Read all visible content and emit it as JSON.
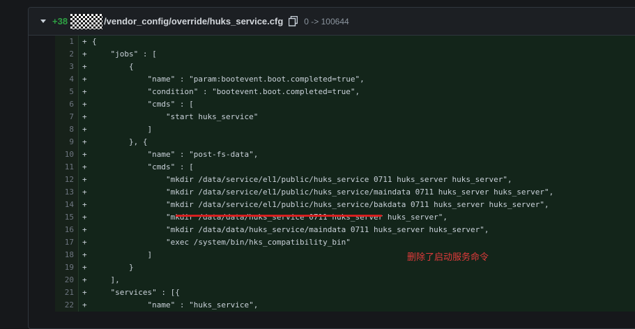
{
  "file_header": {
    "added_count": "+38",
    "path": "/vendor_config/override/huks_service.cfg",
    "mode_change": "0 -> 100644"
  },
  "diff_lines": [
    {
      "num": "1",
      "marker": "+",
      "text": "{"
    },
    {
      "num": "2",
      "marker": "+",
      "text": "    \"jobs\" : ["
    },
    {
      "num": "3",
      "marker": "+",
      "text": "        {"
    },
    {
      "num": "4",
      "marker": "+",
      "text": "            \"name\" : \"param:bootevent.boot.completed=true\","
    },
    {
      "num": "5",
      "marker": "+",
      "text": "            \"condition\" : \"bootevent.boot.completed=true\","
    },
    {
      "num": "6",
      "marker": "+",
      "text": "            \"cmds\" : ["
    },
    {
      "num": "7",
      "marker": "+",
      "text": "                \"start huks_service\""
    },
    {
      "num": "8",
      "marker": "+",
      "text": "            ]"
    },
    {
      "num": "9",
      "marker": "+",
      "text": "        }, {"
    },
    {
      "num": "10",
      "marker": "+",
      "text": "            \"name\" : \"post-fs-data\","
    },
    {
      "num": "11",
      "marker": "+",
      "text": "            \"cmds\" : ["
    },
    {
      "num": "12",
      "marker": "+",
      "text": "                \"mkdir /data/service/el1/public/huks_service 0711 huks_server huks_server\","
    },
    {
      "num": "13",
      "marker": "+",
      "text": "                \"mkdir /data/service/el1/public/huks_service/maindata 0711 huks_server huks_server\","
    },
    {
      "num": "14",
      "marker": "+",
      "text": "                \"mkdir /data/service/el1/public/huks_service/bakdata 0711 huks_server huks_server\","
    },
    {
      "num": "15",
      "marker": "+",
      "text": "                \"mkdir /data/data/huks_service 0711 huks_server huks_server\","
    },
    {
      "num": "16",
      "marker": "+",
      "text": "                \"mkdir /data/data/huks_service/maindata 0711 huks_server huks_server\","
    },
    {
      "num": "17",
      "marker": "+",
      "text": "                \"exec /system/bin/hks_compatibility_bin\""
    },
    {
      "num": "18",
      "marker": "+",
      "text": "            ]"
    },
    {
      "num": "19",
      "marker": "+",
      "text": "        }"
    },
    {
      "num": "20",
      "marker": "+",
      "text": "    ],"
    },
    {
      "num": "21",
      "marker": "+",
      "text": "    \"services\" : [{"
    },
    {
      "num": "22",
      "marker": "+",
      "text": "            \"name\" : \"huks_service\","
    }
  ],
  "annotation": {
    "text": "删除了启动服务命令",
    "color": "#e03b3b"
  },
  "colors": {
    "added_bg": "#13251a",
    "added_count": "#2ea043"
  }
}
